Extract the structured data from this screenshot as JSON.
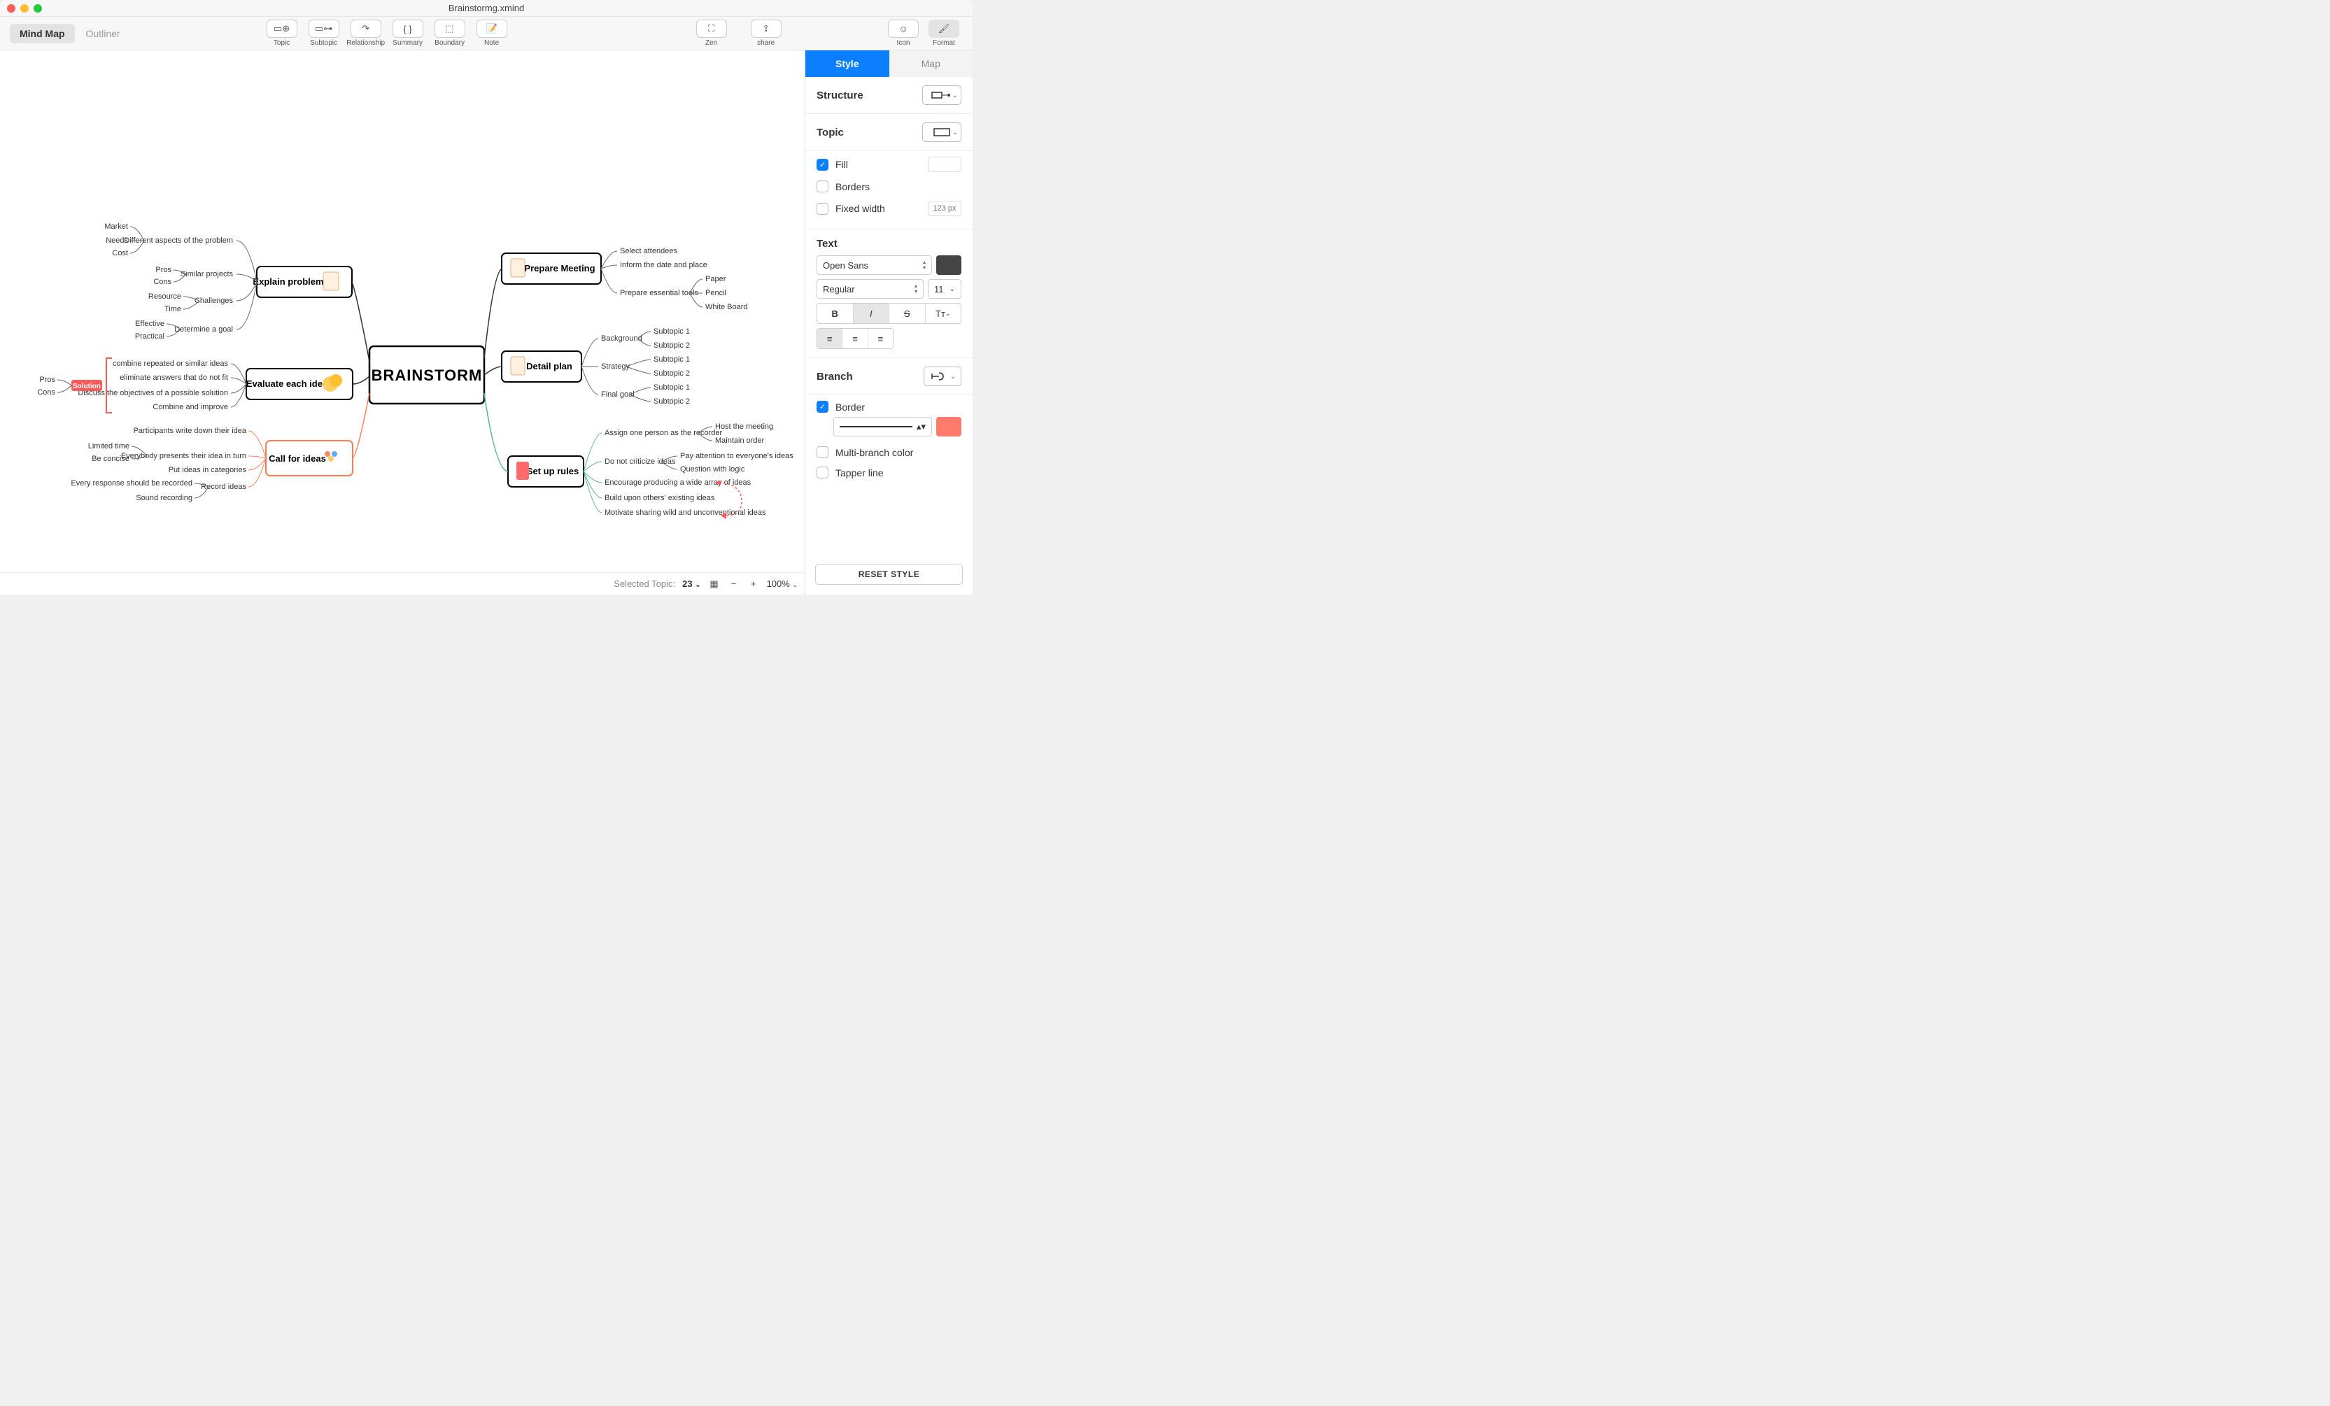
{
  "window": {
    "title": "Brainstormg.xmind"
  },
  "view_tabs": {
    "mindmap": "Mind Map",
    "outliner": "Outliner"
  },
  "toolbar": {
    "topic": "Topic",
    "subtopic": "Subtopic",
    "relationship": "Relationship",
    "summary": "Summary",
    "boundary": "Boundary",
    "note": "Note",
    "zen": "Zen",
    "share": "share",
    "icon": "Icon",
    "format": "Format"
  },
  "mindmap": {
    "central": "BRAINSTORM",
    "left": [
      {
        "label": "Explain problem",
        "children": [
          {
            "label": "Different aspects of the problem",
            "children": [
              "Market",
              "Needs",
              "Cost"
            ]
          },
          {
            "label": "Similar projects",
            "children": [
              "Pros",
              "Cons"
            ]
          },
          {
            "label": "Challenges",
            "children": [
              "Resource",
              "Time"
            ]
          },
          {
            "label": "Determine a goal",
            "children": [
              "Effective",
              "Practical"
            ]
          }
        ]
      },
      {
        "label": "Evaluate each idea",
        "boundary_label": "Solution",
        "boundary_children": [
          "Pros",
          "Cons"
        ],
        "children": [
          "combine repeated or similar ideas",
          "eliminate answers that do not fit",
          "Discuss the objectives of a possible solution",
          "Combine and improve"
        ]
      },
      {
        "label": "Call for ideas",
        "children": [
          {
            "label": "Participants write down their idea"
          },
          {
            "label": "Everybody presents their idea in turn",
            "children": [
              "Limited time",
              "Be concise"
            ]
          },
          {
            "label": "Put ideas in categories"
          },
          {
            "label": "Record ideas",
            "children": [
              "Every response should be recorded",
              "Sound recording"
            ]
          }
        ]
      }
    ],
    "right": [
      {
        "label": "Prepare Meeting",
        "children": [
          "Select attendees",
          "Inform the date and place",
          {
            "label": "Prepare essential tools",
            "children": [
              "Paper",
              "Pencil",
              "White Board"
            ]
          }
        ]
      },
      {
        "label": "Detail plan",
        "children": [
          {
            "label": "Background",
            "children": [
              "Subtopic 1",
              "Subtopic 2"
            ]
          },
          {
            "label": "Strategy",
            "children": [
              "Subtopic 1",
              "Subtopic 2"
            ]
          },
          {
            "label": "Final goal",
            "children": [
              "Subtopic 1",
              "Subtopic 2"
            ]
          }
        ]
      },
      {
        "label": "Set up rules",
        "children": [
          {
            "label": "Assign one person as the recorder",
            "children": [
              "Host the meeting",
              "Maintain order"
            ]
          },
          {
            "label": "Do not criticize ideas",
            "children": [
              "Pay attention to everyone's ideas",
              "Question with logic"
            ]
          },
          "Encourage producing a wide array of ideas",
          "Build upon others' existing ideas",
          "Motivate sharing wild and unconventional ideas"
        ]
      }
    ]
  },
  "panel": {
    "tabs": {
      "style": "Style",
      "map": "Map"
    },
    "structure_label": "Structure",
    "topic_label": "Topic",
    "fill": "Fill",
    "borders": "Borders",
    "fixed_width": "Fixed width",
    "fixed_width_placeholder": "123 px",
    "text_label": "Text",
    "font_family": "Open Sans",
    "font_weight": "Regular",
    "font_size": "11",
    "text_color": "#444444",
    "branch_label": "Branch",
    "border_label": "Border",
    "border_color": "#ff7b6b",
    "multi_branch": "Multi-branch color",
    "tapper": "Tapper line",
    "reset": "RESET STYLE"
  },
  "footer": {
    "selected_label": "Selected Topic:",
    "selected_count": "23",
    "zoom": "100%"
  }
}
